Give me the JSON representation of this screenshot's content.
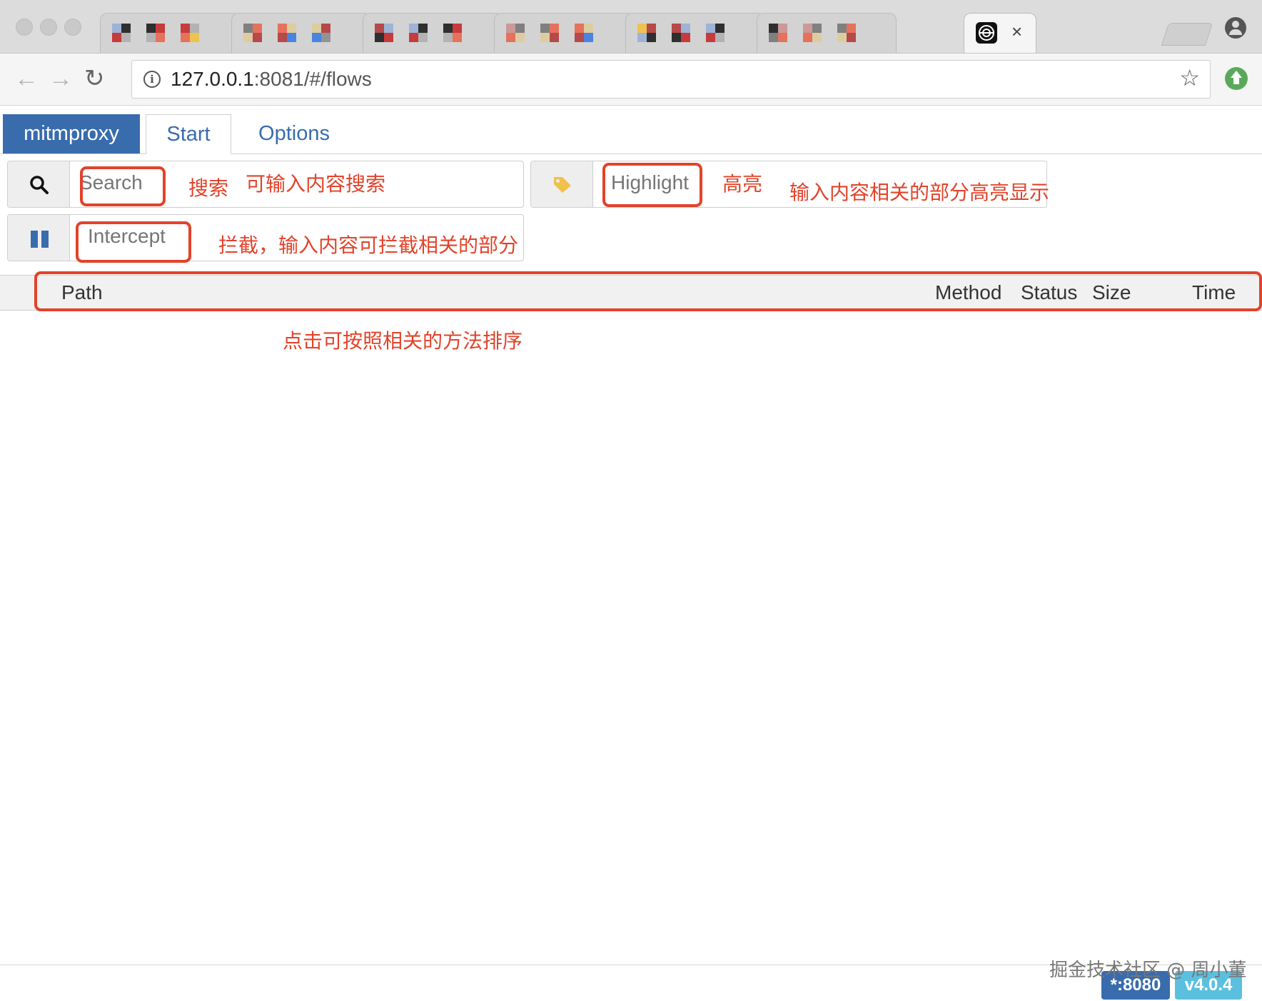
{
  "browser": {
    "active_tab_close": "×",
    "url_host": "127.0.0.1",
    "url_rest": ":8081/#/flows"
  },
  "app": {
    "brand": "mitmproxy",
    "tabs": [
      "Start",
      "Options"
    ],
    "search_placeholder": "Search",
    "highlight_placeholder": "Highlight",
    "intercept_placeholder": "Intercept",
    "columns": {
      "path": "Path",
      "method": "Method",
      "status": "Status",
      "size": "Size",
      "time": "Time"
    },
    "footer": {
      "listen": "*:8080",
      "version": "v4.0.4"
    }
  },
  "annotations": {
    "search_label": "搜索",
    "search_desc": "可输入内容搜索",
    "highlight_label": "高亮",
    "highlight_desc": "输入内容相关的部分高亮显示",
    "intercept_desc": "拦截，输入内容可拦截相关的部分",
    "sort_desc": "点击可按照相关的方法排序",
    "watermark": "掘金技术社区 @ 周小董"
  },
  "colors": {
    "brand_bg": "#396cad",
    "annotation_red": "#e2432a",
    "listen_badge": "#396cad",
    "version_badge": "#5bc0de"
  }
}
